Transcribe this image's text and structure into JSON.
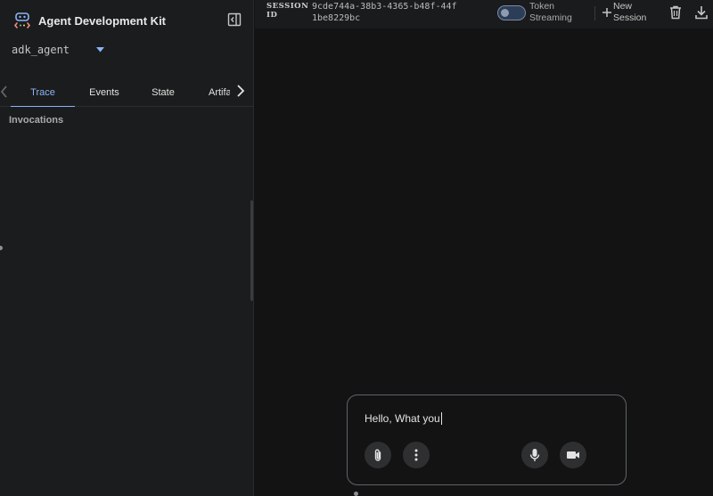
{
  "app": {
    "title": "Agent Development Kit",
    "logo_icon": "adk-logo-icon",
    "collapse_icon": "sidebar-collapse-icon"
  },
  "agent_selector": {
    "value": "adk_agent",
    "icon": "chevron-down-icon"
  },
  "tabs": [
    {
      "label": "Trace",
      "active": true
    },
    {
      "label": "Events",
      "active": false
    },
    {
      "label": "State",
      "active": false
    },
    {
      "label": "Artifa",
      "active": false
    }
  ],
  "trace": {
    "section_label": "Invocations"
  },
  "session": {
    "label": "SESSION ID",
    "id": "9cde744a-38b3-4365-b48f-44f1be8229bc"
  },
  "streaming": {
    "label": "Token Streaming",
    "enabled": false
  },
  "toolbar": {
    "new_session_label": "New Session",
    "new_session_icon": "plus-icon",
    "delete_icon": "trash-icon",
    "download_icon": "download-icon"
  },
  "composer": {
    "value": "Hello, What you",
    "buttons": [
      "paperclip-icon",
      "more-vert-icon",
      "mic-icon",
      "videocam-icon"
    ]
  },
  "colors": {
    "accent": "#8ab4f8",
    "sidebar_bg": "#1b1c1d",
    "main_bg": "#131314"
  }
}
